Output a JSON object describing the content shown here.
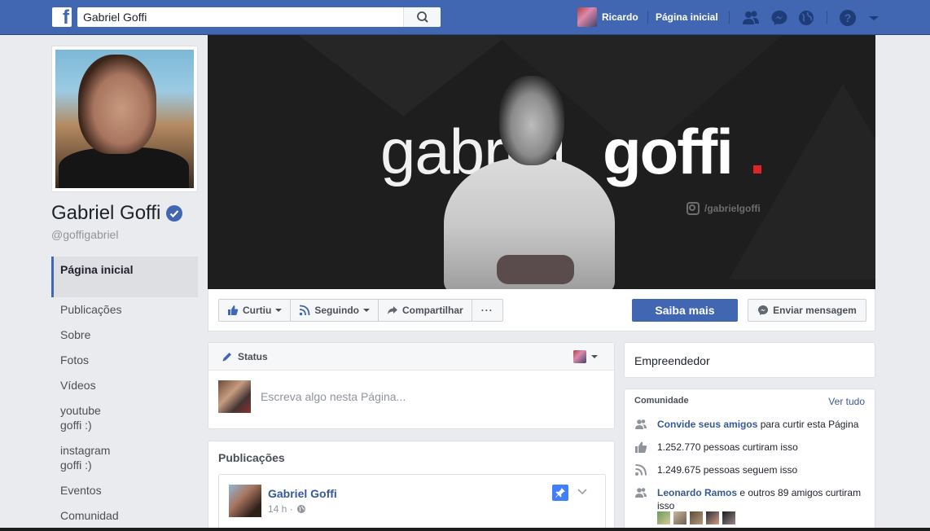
{
  "topbar": {
    "search_value": "Gabriel Goffi",
    "user_name": "Ricardo",
    "home_label": "Página inicial"
  },
  "page": {
    "name": "Gabriel Goffi",
    "handle": "@goffigabriel"
  },
  "sidebar": {
    "items": [
      {
        "label": "Página inicial"
      },
      {
        "label": "Publicações"
      },
      {
        "label": "Sobre"
      },
      {
        "label": "Fotos"
      },
      {
        "label": "Vídeos"
      },
      {
        "label": "youtube goffi :)"
      },
      {
        "label": "instagram goffi :)"
      },
      {
        "label": "Eventos"
      },
      {
        "label": "Comunidad"
      }
    ]
  },
  "cover": {
    "word_light": "gabriel",
    "word_bold": "goffi",
    "instagram": "/gabrielgoffi"
  },
  "actions": {
    "like": "Curtiu",
    "follow": "Seguindo",
    "share": "Compartilhar",
    "more": "···",
    "learn_more": "Saiba mais",
    "message": "Enviar mensagem"
  },
  "composer": {
    "tab": "Status",
    "placeholder": "Escreva algo nesta Página..."
  },
  "posts": {
    "header": "Publicações",
    "items": [
      {
        "author": "Gabriel Goffi",
        "time": "14 h ·"
      }
    ]
  },
  "category": "Empreendedor",
  "community": {
    "title": "Comunidade",
    "see_all": "Ver tudo",
    "invite_link": "Convide seus amigos",
    "invite_rest": " para curtir esta Página",
    "likes": "1.252.770 pessoas curtiram isso",
    "follows": "1.249.675 pessoas seguem isso",
    "friends_link": "Leonardo Ramos",
    "friends_rest": " e outros 89 amigos curtiram isso"
  },
  "colors": {
    "brand": "#4267b2",
    "link": "#365899",
    "background": "#e9ebee"
  }
}
